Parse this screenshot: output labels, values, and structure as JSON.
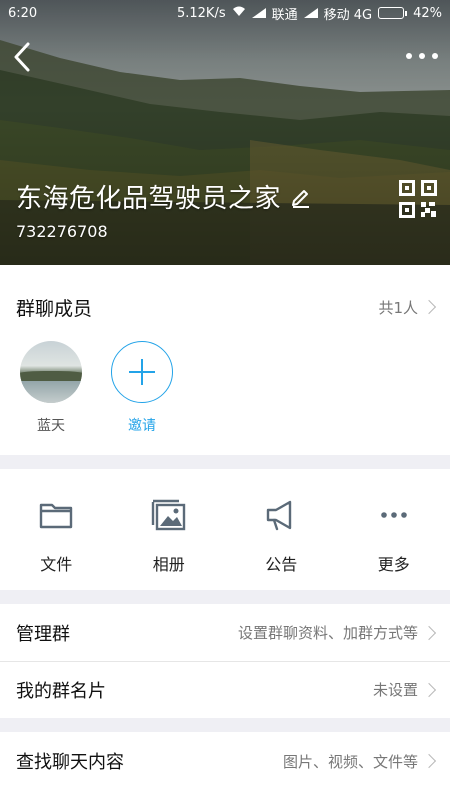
{
  "status_bar": {
    "time": "6:20",
    "speed": "5.12K/s",
    "carrier1": "联通",
    "carrier2": "移动 4G",
    "battery": "42%",
    "battery_level": 0.42
  },
  "header": {
    "group_name": "东海危化品驾驶员之家",
    "group_id": "732276708"
  },
  "members": {
    "title": "群聊成员",
    "count": "共1人",
    "items": [
      {
        "label": "蓝天"
      },
      {
        "label": "邀请"
      }
    ]
  },
  "actions": [
    {
      "label": "文件",
      "icon": "folder-icon"
    },
    {
      "label": "相册",
      "icon": "album-icon"
    },
    {
      "label": "公告",
      "icon": "megaphone-icon"
    },
    {
      "label": "更多",
      "icon": "more-icon"
    }
  ],
  "settings": [
    {
      "title": "管理群",
      "value": "设置群聊资料、加群方式等"
    },
    {
      "title": "我的群名片",
      "value": "未设置"
    },
    {
      "title": "查找聊天内容",
      "value": "图片、视频、文件等"
    }
  ],
  "colors": {
    "accent": "#23a3e8",
    "icon_gray": "#5b6a78"
  }
}
